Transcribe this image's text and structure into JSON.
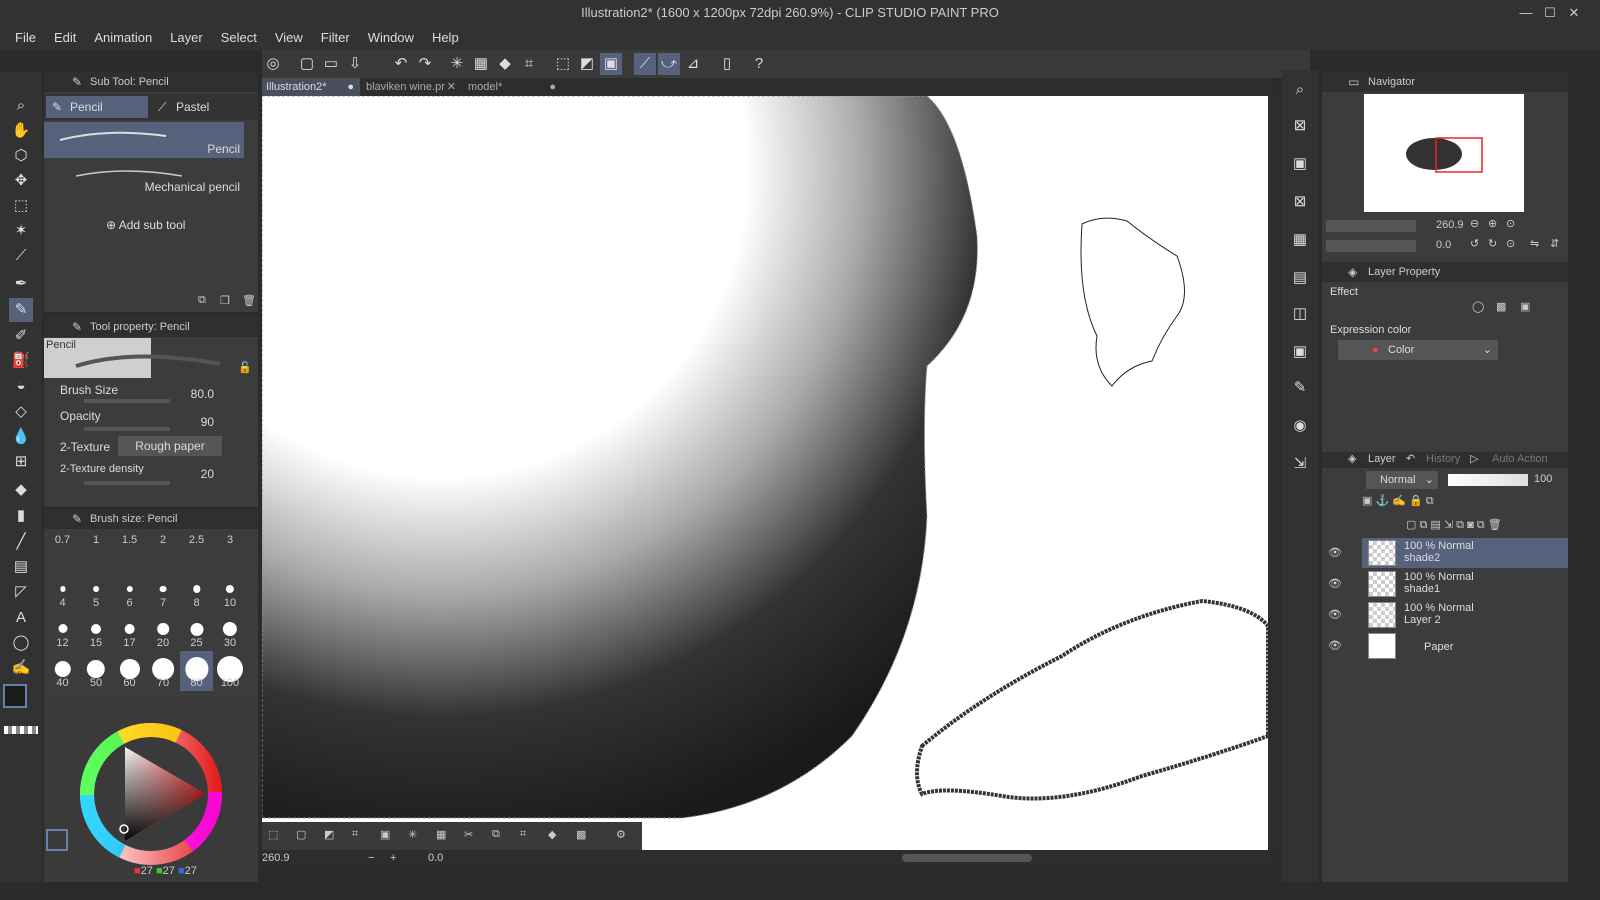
{
  "window": {
    "title": "Illustration2* (1600 x 1200px 72dpi 260.9%) - CLIP STUDIO PAINT PRO",
    "minimize": "—",
    "maximize": "☐",
    "close": "✕"
  },
  "menu": [
    "File",
    "Edit",
    "Animation",
    "Layer",
    "Select",
    "View",
    "Filter",
    "Window",
    "Help"
  ],
  "subtool": {
    "header": "Sub Tool: Pencil",
    "tabs": [
      "Pencil",
      "Pastel"
    ],
    "brushes": [
      "Pencil",
      "Mechanical pencil"
    ],
    "add_label": "Add sub tool"
  },
  "tool_property": {
    "header": "Tool property: Pencil",
    "preview_label": "Pencil",
    "brush_size_label": "Brush Size",
    "brush_size_value": "80.0",
    "opacity_label": "Opacity",
    "opacity_value": "90",
    "texture_label": "2-Texture",
    "texture_value": "Rough paper",
    "density_label": "2-Texture density",
    "density_value": "20"
  },
  "brush_size_panel": {
    "header": "Brush size: Pencil",
    "sizes": [
      "0.7",
      "1",
      "1.5",
      "2",
      "2.5",
      "3",
      "4",
      "5",
      "6",
      "7",
      "8",
      "10",
      "12",
      "15",
      "17",
      "20",
      "25",
      "30",
      "40",
      "50",
      "60",
      "70",
      "80",
      "100"
    ],
    "selected": "80"
  },
  "color": {
    "r": "27",
    "g": "27",
    "b": "27",
    "main": "#1b1b1b",
    "sub": "#ffffff"
  },
  "doc_tabs": [
    "Illustration2*",
    "blaviken wine.pr",
    "model*"
  ],
  "status": {
    "zoom": "260.9",
    "angle": "0.0"
  },
  "navigator": {
    "header": "Navigator",
    "zoom": "260.9",
    "rotation": "0.0"
  },
  "layer_property": {
    "header": "Layer Property",
    "effect_label": "Effect",
    "expression_label": "Expression color",
    "expression_value": "Color"
  },
  "layer_panel": {
    "tabs": [
      "Layer",
      "History",
      "Auto Action"
    ],
    "blend_mode": "Normal",
    "opacity": "100",
    "layers": [
      {
        "mode": "100 % Normal",
        "name": "shade2",
        "selected": true
      },
      {
        "mode": "100 % Normal",
        "name": "shade1",
        "selected": false
      },
      {
        "mode": "100 % Normal",
        "name": "Layer 2",
        "selected": false
      },
      {
        "mode": "",
        "name": "Paper",
        "selected": false
      }
    ]
  }
}
